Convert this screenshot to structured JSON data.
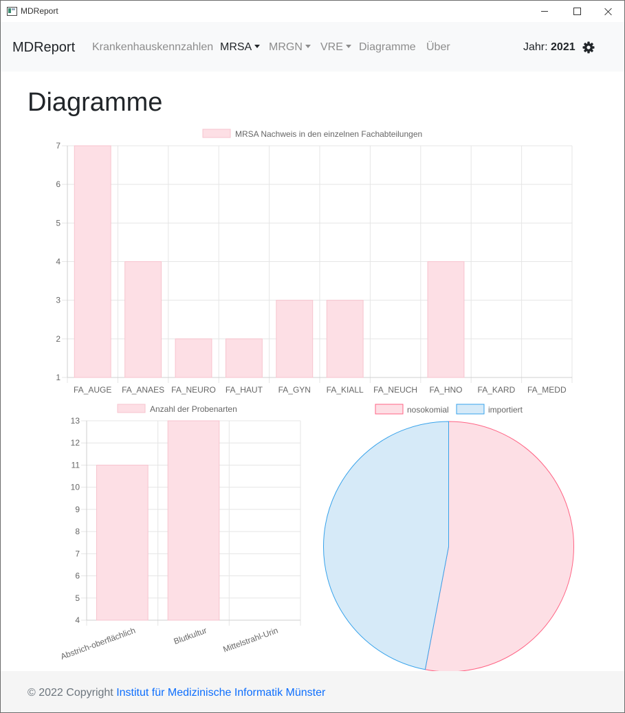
{
  "window": {
    "title": "MDReport"
  },
  "navbar": {
    "brand": "MDReport",
    "items": [
      {
        "label": "Krankenhauskennzahlen"
      },
      {
        "label": "MRSA"
      },
      {
        "label": "MRGN"
      },
      {
        "label": "VRE"
      },
      {
        "label": "Diagramme"
      },
      {
        "label": "Über"
      }
    ],
    "year_label": "Jahr:",
    "year_value": "2021"
  },
  "page": {
    "title": "Diagramme"
  },
  "footer": {
    "copyright": "© 2022 Copyright",
    "link_text": "Institut für Medizinische Informatik Münster"
  },
  "colors": {
    "bar_fill": "#fddfe5",
    "bar_border": "#f7c3ce",
    "pink_border": "#ff6384",
    "blue_fill": "#d6eaf8",
    "blue_border": "#36a2eb",
    "link": "#0d6efd"
  },
  "chart_data": [
    {
      "type": "bar",
      "legend": [
        "MRSA Nachweis in den einzelnen Fachabteilungen"
      ],
      "categories": [
        "FA_AUGE",
        "FA_ANAES",
        "FA_NEURO",
        "FA_HAUT",
        "FA_GYN",
        "FA_KIALL",
        "FA_NEUCH",
        "FA_HNO",
        "FA_KARD",
        "FA_MEDD"
      ],
      "values": [
        7,
        4,
        2,
        2,
        3,
        3,
        0,
        4,
        0,
        0
      ],
      "ylim": [
        1,
        7
      ],
      "yticks": [
        "7",
        "6",
        "5",
        "4",
        "3",
        "2",
        "1"
      ],
      "grid": true,
      "legend_position": "top"
    },
    {
      "type": "bar",
      "legend": [
        "Anzahl der Probenarten"
      ],
      "categories": [
        "Abstrich-oberflächlich",
        "Blutkultur",
        "Mittelstrahl-Urin"
      ],
      "values": [
        11,
        13,
        0
      ],
      "ylim": [
        4,
        13
      ],
      "yticks": [
        "13",
        "12",
        "11",
        "10",
        "9",
        "8",
        "7",
        "6",
        "5",
        "4"
      ],
      "grid": true,
      "legend_position": "top"
    },
    {
      "type": "pie",
      "labels": [
        "nosokomial",
        "importiert"
      ],
      "values": [
        53,
        47
      ],
      "legend_position": "top"
    }
  ]
}
